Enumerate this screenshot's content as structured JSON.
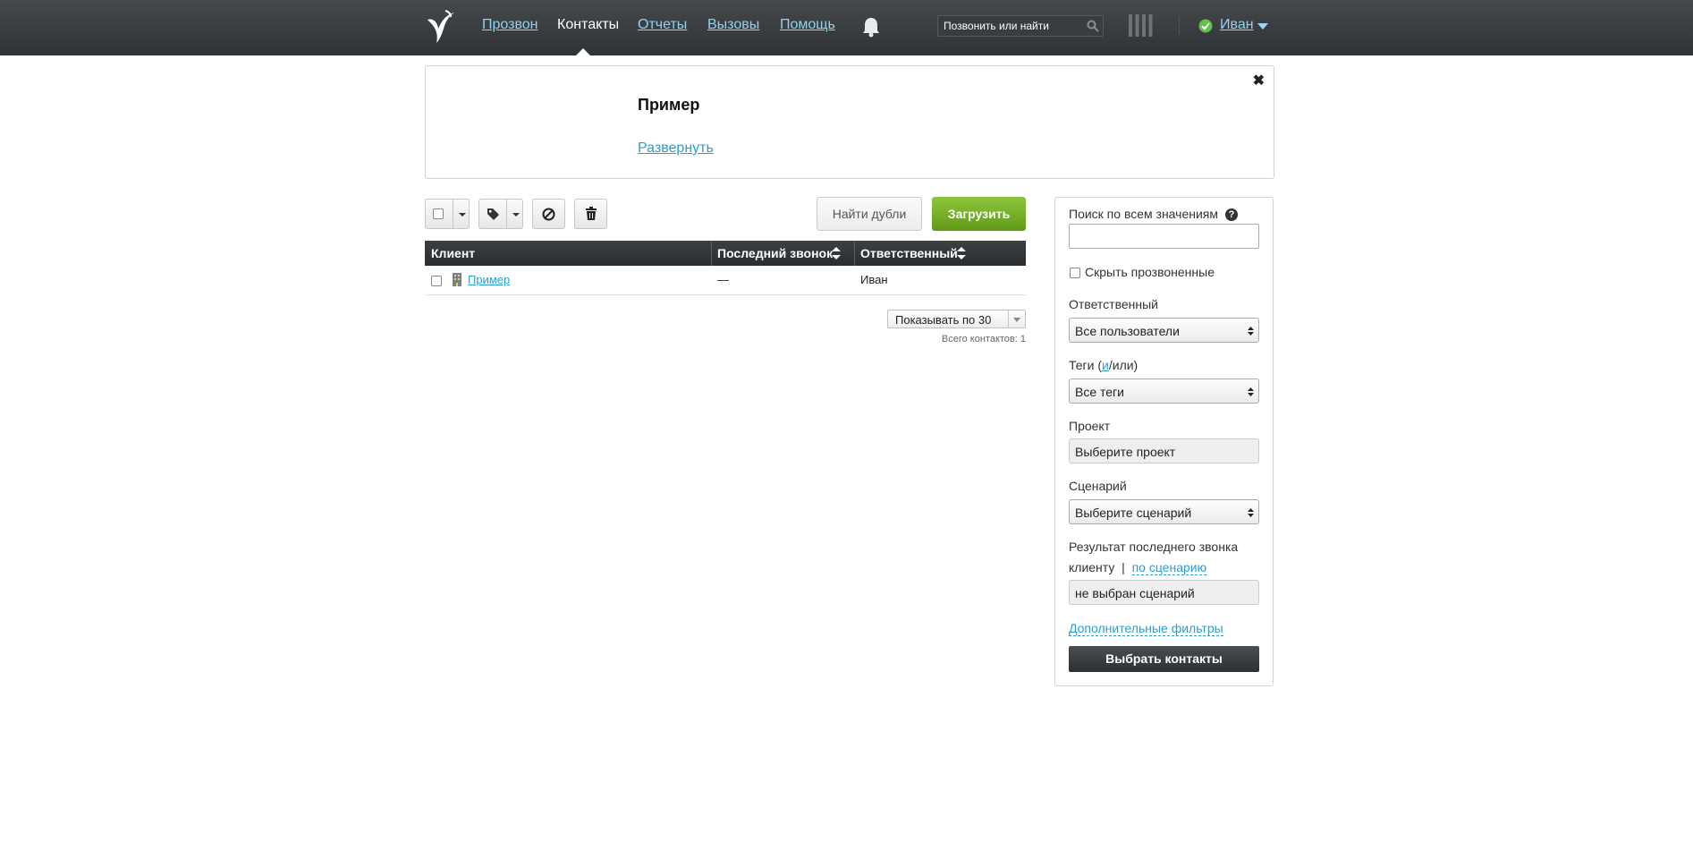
{
  "header": {
    "nav": [
      "Прозвон",
      "Контакты",
      "Отчеты",
      "Вызовы",
      "Помощь"
    ],
    "active_nav": "Контакты",
    "search_placeholder": "Позвонить или найти",
    "user_name": "Иван",
    "icons": [
      "logo-bird-icon",
      "bell-icon",
      "search-icon",
      "bars-icon",
      "status-ok-icon",
      "chevron-down-icon"
    ]
  },
  "notice": {
    "title": "Пример",
    "expand_link": "Развернуть",
    "close_icon": "close-icon"
  },
  "toolbar": {
    "find_duplicates": "Найти дубли",
    "upload": "Загрузить",
    "icons": [
      "checkbox-icon",
      "tag-icon",
      "block-icon",
      "trash-icon"
    ]
  },
  "table": {
    "columns": [
      "Клиент",
      "Последний звонок",
      "Ответственный"
    ],
    "rows": [
      {
        "client": "Пример",
        "last_call": "—",
        "owner": "Иван"
      }
    ],
    "page_size_label": "Показывать по 30",
    "total": "Всего контактов: 1"
  },
  "filters": {
    "search_label": "Поиск по всем значениям",
    "search_value": "",
    "hide_called": "Скрыть прозвоненные",
    "owner_label": "Ответственный",
    "owner_value": "Все пользователи",
    "tags_label_prefix": "Теги (",
    "tags_label_link": "и",
    "tags_label_suffix": "/или)",
    "tags_value": "Все теги",
    "project_label": "Проект",
    "project_value": "Выберите проект",
    "scenario_label": "Сценарий",
    "scenario_value": "Выберите сценарий",
    "result_label_1": "Результат последнего звонка",
    "result_label_2": "клиенту",
    "result_sep": "|",
    "result_link": "по сценарию",
    "result_value": "не выбран сценарий",
    "more_filters": "Дополнительные фильтры",
    "submit": "Выбрать контакты"
  },
  "colors": {
    "header_bg": "#3a3e41",
    "link": "#2a9fd0",
    "upload_green": "#74b12a",
    "status_green": "#5fc24b"
  }
}
